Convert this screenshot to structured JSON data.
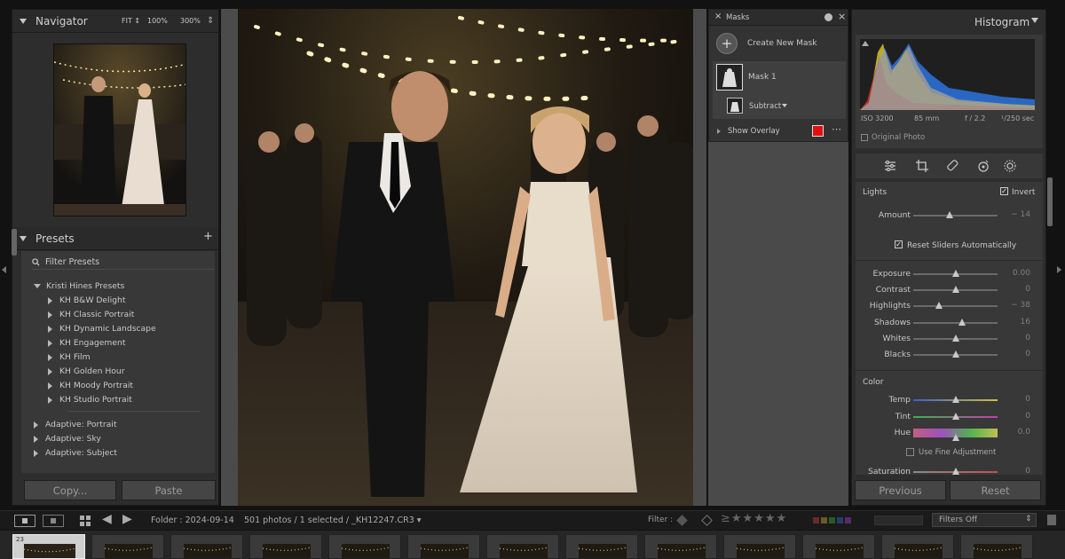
{
  "navigator": {
    "title": "Navigator",
    "zoom": [
      "FIT ↕",
      "100%",
      "300%"
    ]
  },
  "presets": {
    "title": "Presets",
    "filter_placeholder": "Filter Presets",
    "group": "Kristi Hines Presets",
    "items": [
      "KH B&W Delight",
      "KH Classic Portrait",
      "KH Dynamic Landscape",
      "KH Engagement",
      "KH Film",
      "KH Golden Hour",
      "KH Moody Portrait",
      "KH Studio Portrait"
    ],
    "adaptive": [
      "Adaptive: Portrait",
      "Adaptive: Sky",
      "Adaptive: Subject"
    ]
  },
  "left_buttons": {
    "copy": "Copy...",
    "paste": "Paste"
  },
  "masks": {
    "title": "Masks",
    "create": "Create New Mask",
    "mask1": "Mask 1",
    "subtract": "Subtract",
    "show_overlay": "Show Overlay",
    "overlay_color": "#e01010"
  },
  "histogram": {
    "title": "Histogram",
    "iso": "ISO 3200",
    "focal": "85 mm",
    "aperture": "f / 2.2",
    "shutter": "¹/250 sec",
    "original_photo": "Original Photo"
  },
  "mask_adjust": {
    "section": "Lights",
    "invert_label": "Invert",
    "invert": true,
    "amount": {
      "label": "Amount",
      "value": "− 14",
      "level": -0.14
    },
    "reset_auto": "Reset Sliders Automatically",
    "light": [
      {
        "label": "Exposure",
        "value": "0.00",
        "level": 0
      },
      {
        "label": "Contrast",
        "value": "0",
        "level": 0
      },
      {
        "label": "Highlights",
        "value": "− 38",
        "level": -0.38
      },
      {
        "label": "Shadows",
        "value": "16",
        "level": 0.16
      },
      {
        "label": "Whites",
        "value": "0",
        "level": 0
      },
      {
        "label": "Blacks",
        "value": "0",
        "level": 0
      }
    ],
    "color_section": "Color",
    "color": [
      {
        "label": "Temp",
        "value": "0",
        "level": 0
      },
      {
        "label": "Tint",
        "value": "0",
        "level": 0
      },
      {
        "label": "Hue",
        "value": "0.0",
        "level": 0
      }
    ],
    "fine": "Use Fine Adjustment",
    "saturation": {
      "label": "Saturation",
      "value": "0",
      "level": 0
    }
  },
  "right_buttons": {
    "previous": "Previous",
    "reset": "Reset"
  },
  "filmstrip": {
    "folder": "Folder : 2024-09-14",
    "count": "501 photos / 1 selected / _KH12247.CR3 ▾",
    "filter_label": "Filter :",
    "filters_off": "Filters Off",
    "frame_number": "23"
  }
}
